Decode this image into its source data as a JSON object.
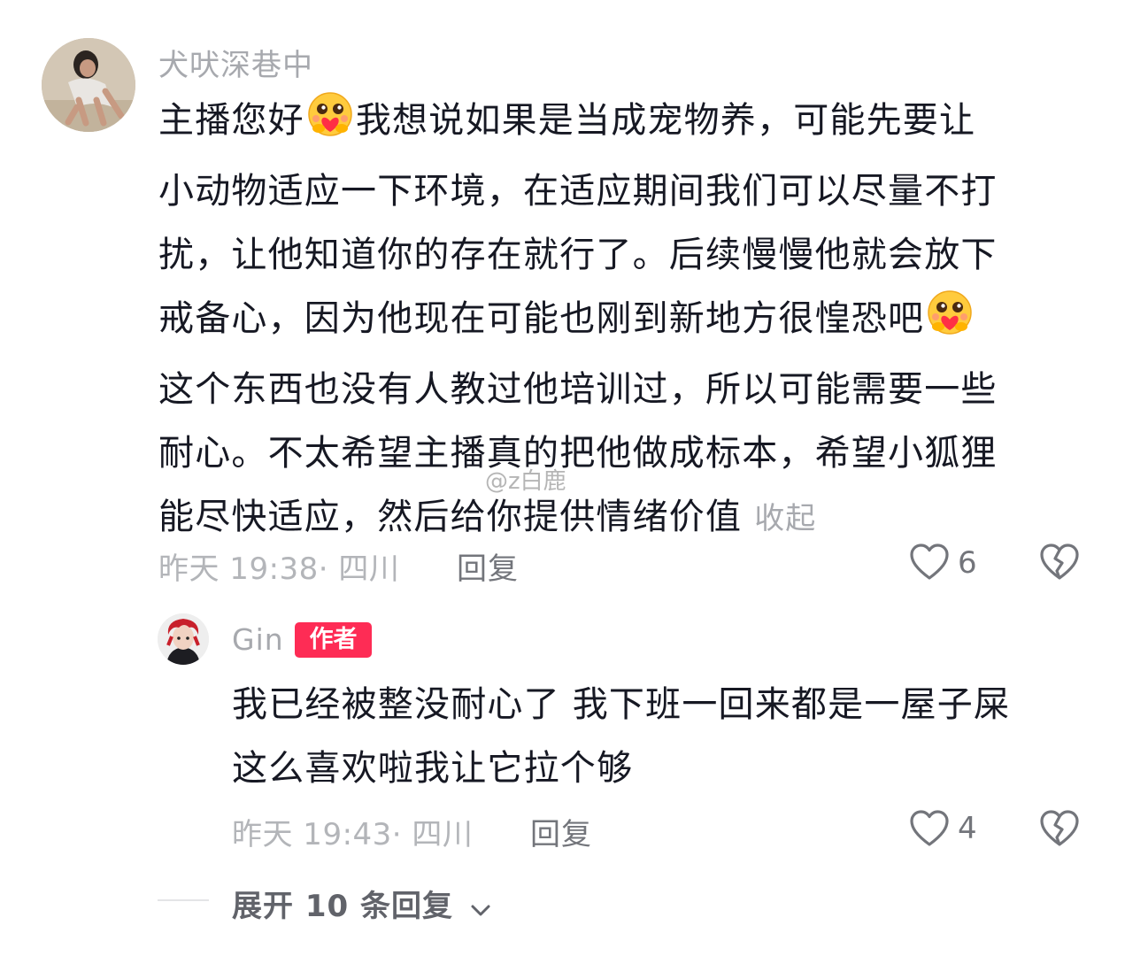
{
  "main_comment": {
    "username": "犬吠深巷中",
    "lines": [
      "主播您好",
      "我想说如果是当成宠物养，可能先要让",
      "小动物适应一下环境，在适应期间我们可以尽量不打",
      "扰，让他知道你的存在就行了。后续慢慢他就会放下",
      "戒备心，因为他现在可能也刚到新地方很惶恐吧",
      "这个东西也没有人教过他培训过，所以可能需要一些",
      "耐心。不太希望主播真的把他做成标本，希望小狐狸",
      "能尽快适应，然后给你提供情绪价值"
    ],
    "collapse_label": "收起",
    "timestamp": "昨天 19:38· 四川",
    "reply_label": "回复",
    "likes": "6",
    "emoji_icons": [
      "hugging-face-icon",
      "hugging-face-icon"
    ]
  },
  "reply_comment": {
    "username": "Gin",
    "author_badge": "作者",
    "lines": [
      "我已经被整没耐心了 我下班一回来都是一屋子屎",
      "这么喜欢啦我让它拉个够"
    ],
    "timestamp": "昨天 19:43· 四川",
    "reply_label": "回复",
    "likes": "4"
  },
  "expand_replies": {
    "label": "展开 10 条回复"
  },
  "watermark": "@z白鹿",
  "colors": {
    "text_primary": "#161823",
    "text_secondary": "#a7a9ae",
    "badge": "#fe2c55",
    "icon": "#73757b"
  }
}
